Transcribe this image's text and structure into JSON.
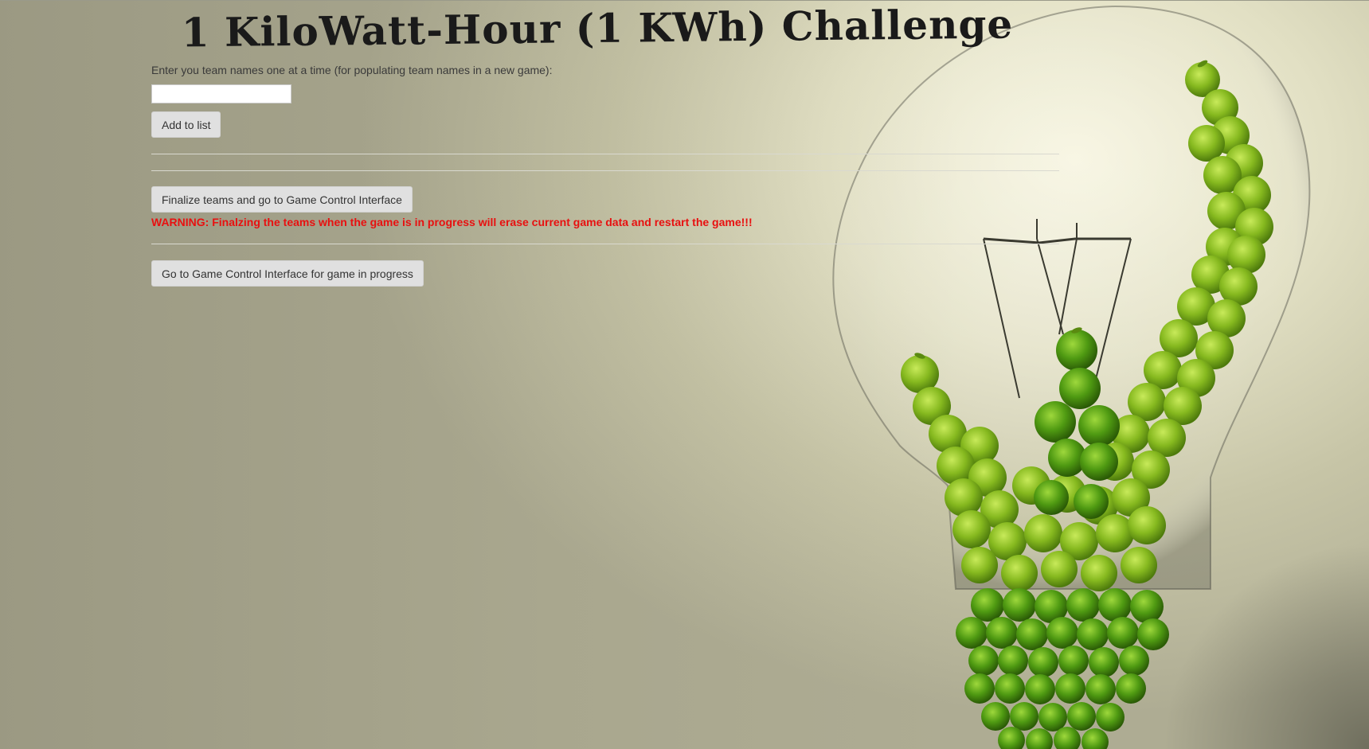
{
  "page": {
    "title": "1 KiloWatt-Hour (1 KWh) Challenge"
  },
  "team_entry": {
    "instructions": "Enter you team names one at a time (for populating team names in a new game):",
    "input_value": "",
    "input_placeholder": "",
    "add_button_label": "Add to list"
  },
  "finalize": {
    "button_label": "Finalize teams and go to Game Control Interface",
    "warning_text": "WARNING: Finalzing the teams when the game is in progress will erase current game data and restart the game!!!"
  },
  "in_progress": {
    "button_label": "Go to Game Control Interface for game in progress"
  },
  "colors": {
    "warning": "#e81010",
    "apple_green": "#7fb51e"
  },
  "background_art": {
    "icon": "lightbulb-made-of-green-apples"
  }
}
